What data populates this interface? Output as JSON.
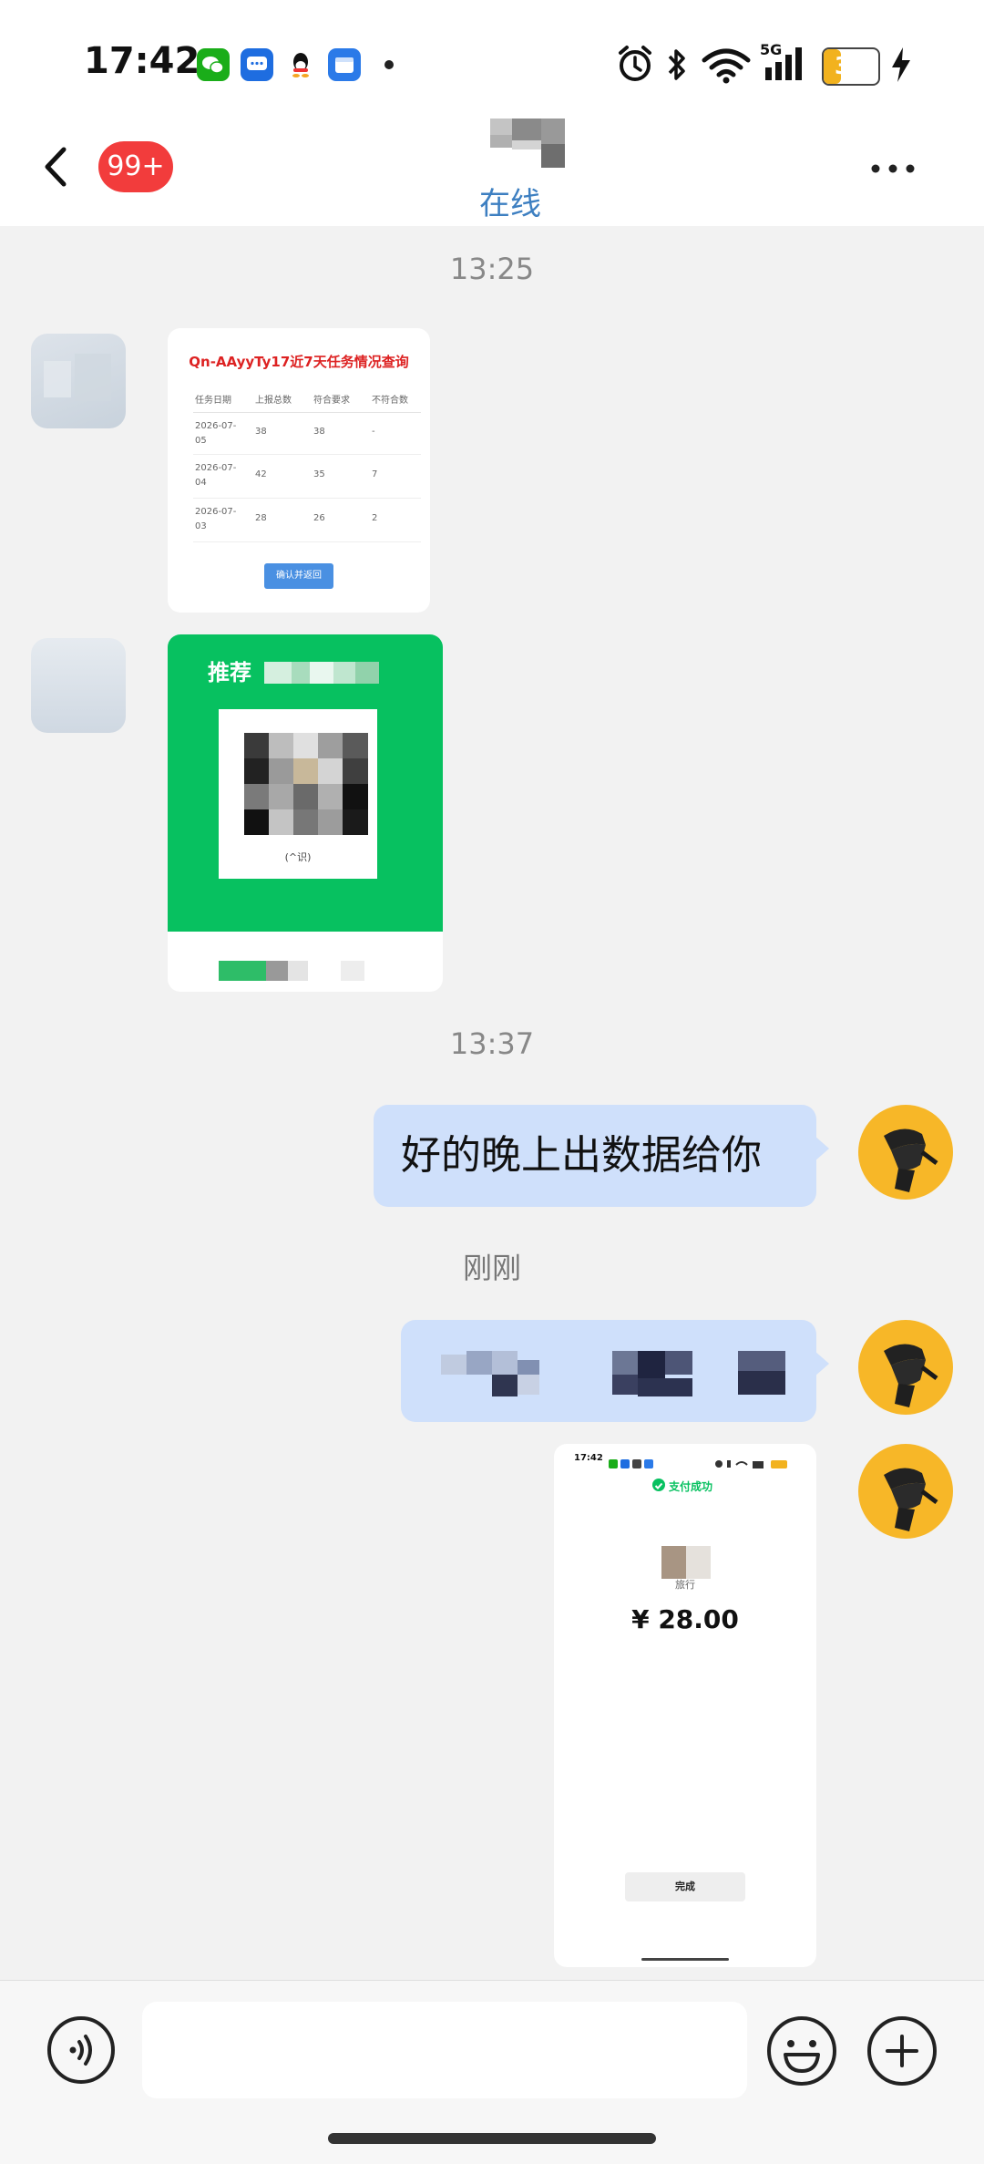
{
  "status_bar": {
    "time": "17:42",
    "battery": "31",
    "battery_level": 0.31,
    "network": "5G",
    "icons": [
      "wechat-icon",
      "messages-icon",
      "qq-icon",
      "files-icon",
      "alarm-icon",
      "bluetooth-icon",
      "wifi-icon",
      "signal-icon",
      "charging-icon"
    ]
  },
  "header": {
    "unread_badge": "99+",
    "status": "在线"
  },
  "chat": {
    "timestamps": [
      "13:25",
      "13:37",
      "刚刚"
    ],
    "table_card": {
      "title": "Qn-AAyyTy17近7天任务情况查询",
      "headers": [
        "任务日期",
        "上报总数",
        "符合要求",
        "不符合数"
      ],
      "rows": [
        [
          "2026-07-05",
          "38",
          "38",
          "-"
        ],
        [
          "2026-07-04",
          "42",
          "35",
          "7"
        ],
        [
          "2026-07-03",
          "28",
          "26",
          "2"
        ]
      ],
      "button": "确认并返回"
    },
    "green_card": {
      "title": "推荐",
      "caption": "(^识)"
    },
    "sent_message": "好的晚上出数据给你",
    "payment_card": {
      "time": "17:42",
      "status": "支付成功",
      "merchant": "旅行",
      "amount": "¥ 28.00",
      "done_button": "完成"
    }
  },
  "colors": {
    "accent": "#3d7fc1",
    "badge": "#f23c3c",
    "bubble": "#cfe0fb",
    "wechat_green": "#07c160",
    "avatar": "#f7b728"
  }
}
